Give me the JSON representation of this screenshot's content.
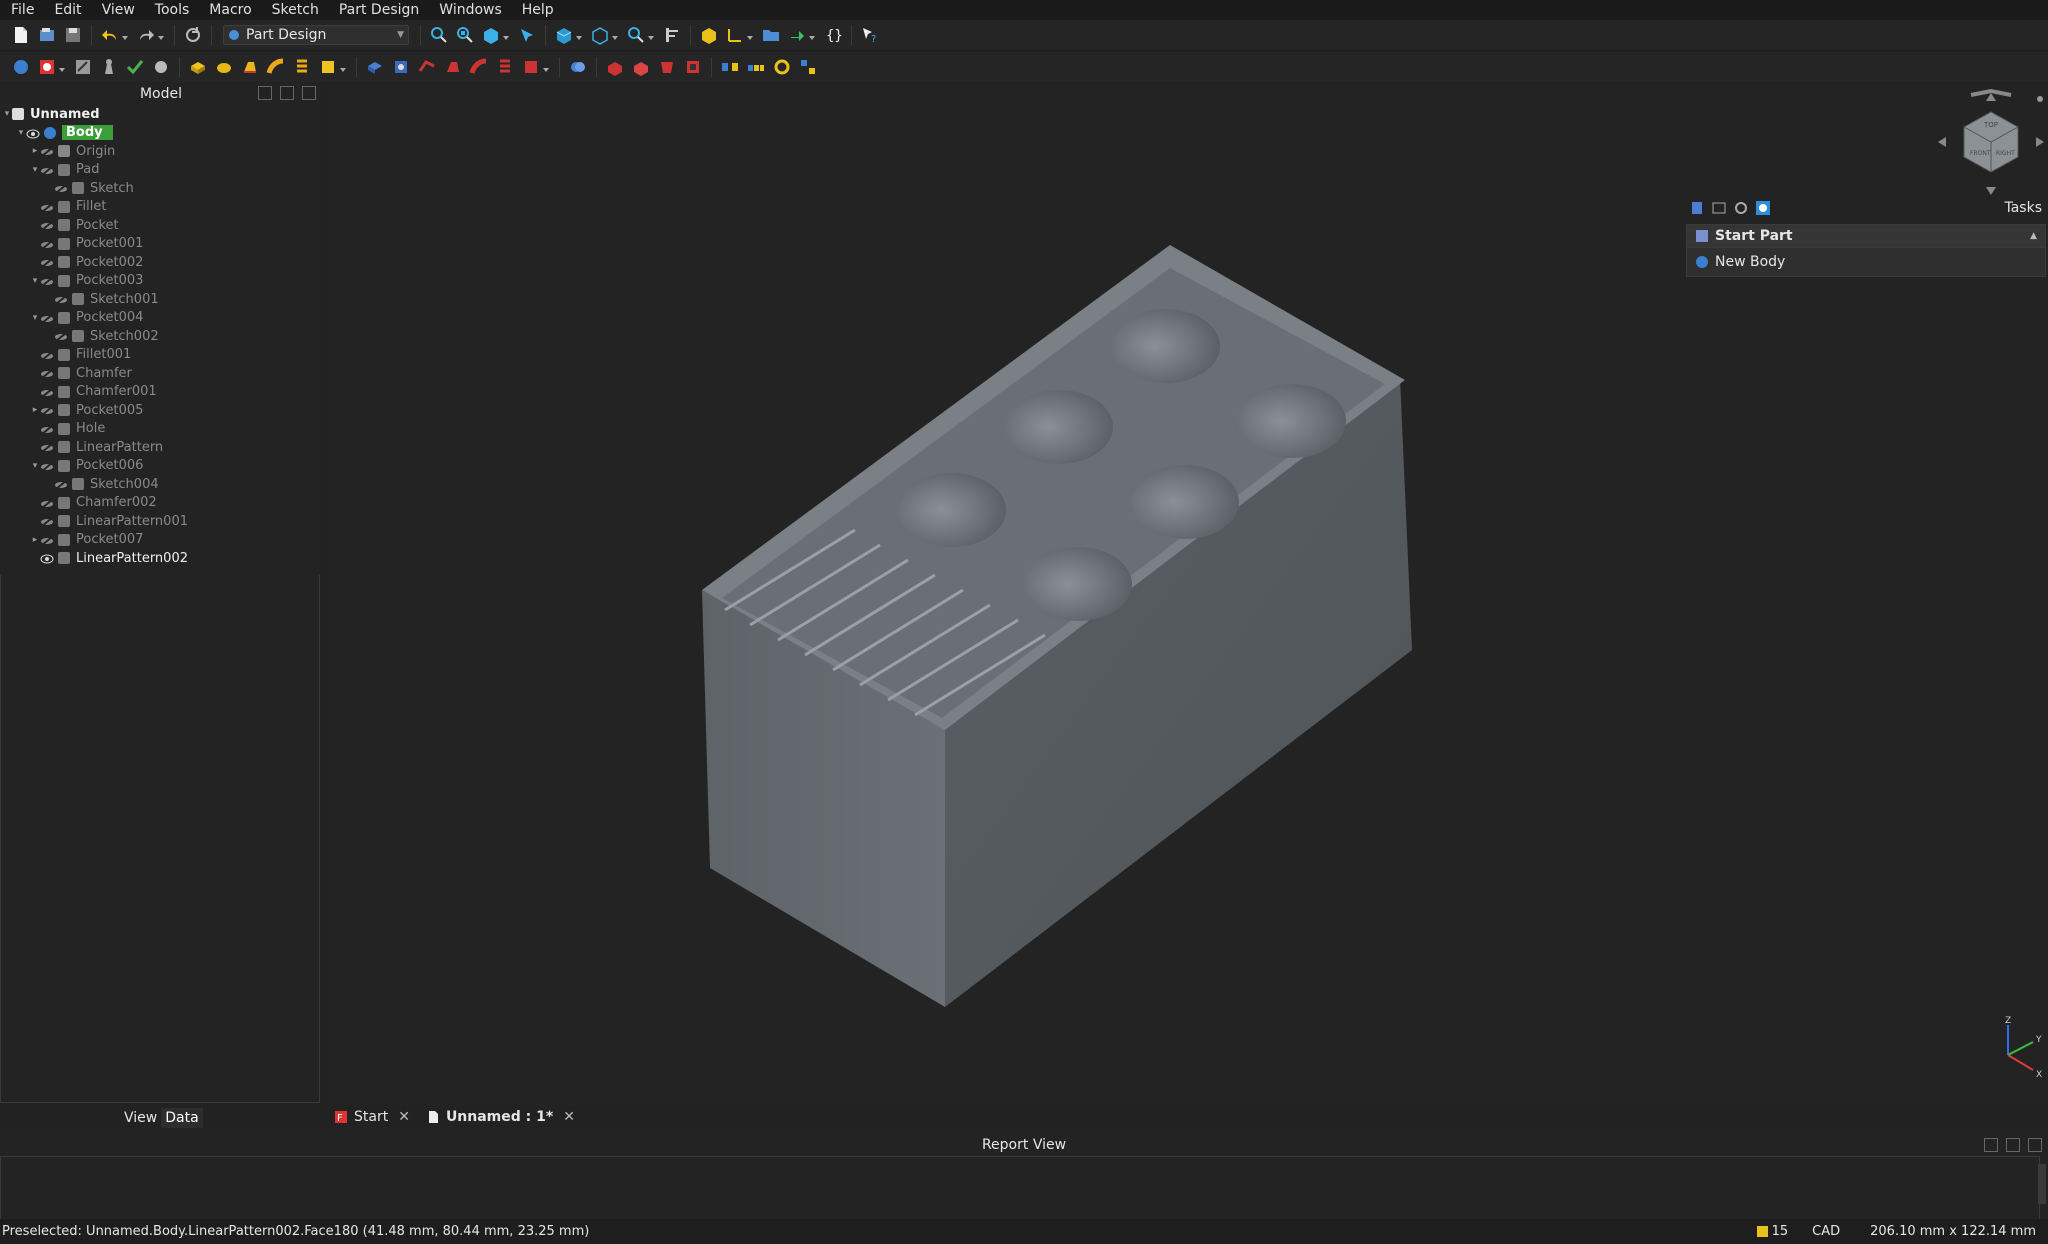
{
  "menu": [
    "File",
    "Edit",
    "View",
    "Tools",
    "Macro",
    "Sketch",
    "Part Design",
    "Windows",
    "Help"
  ],
  "workbench": {
    "label": "Part Design"
  },
  "model_panel": {
    "title": "Model"
  },
  "tree": [
    {
      "label": "Unnamed",
      "level": 0,
      "arrow": "down",
      "bright": true,
      "icon": "document-icon"
    },
    {
      "label": "Body",
      "level": 1,
      "arrow": "down",
      "selected": true,
      "icon": "body-icon"
    },
    {
      "label": "Origin",
      "level": 2,
      "arrow": "right",
      "icon": "origin-icon"
    },
    {
      "label": "Pad",
      "level": 2,
      "arrow": "down",
      "icon": "pad-icon"
    },
    {
      "label": "Sketch",
      "level": 3,
      "arrow": "",
      "icon": "sketch-icon"
    },
    {
      "label": "Fillet",
      "level": 2,
      "arrow": "",
      "icon": "fillet-icon"
    },
    {
      "label": "Pocket",
      "level": 2,
      "arrow": "",
      "icon": "pocket-icon"
    },
    {
      "label": "Pocket001",
      "level": 2,
      "arrow": "",
      "icon": "pocket-icon"
    },
    {
      "label": "Pocket002",
      "level": 2,
      "arrow": "",
      "icon": "pocket-icon"
    },
    {
      "label": "Pocket003",
      "level": 2,
      "arrow": "down",
      "icon": "pocket-icon"
    },
    {
      "label": "Sketch001",
      "level": 3,
      "arrow": "",
      "icon": "sketch-icon"
    },
    {
      "label": "Pocket004",
      "level": 2,
      "arrow": "down",
      "icon": "pocket-icon"
    },
    {
      "label": "Sketch002",
      "level": 3,
      "arrow": "",
      "icon": "sketch-icon"
    },
    {
      "label": "Fillet001",
      "level": 2,
      "arrow": "",
      "icon": "fillet-icon"
    },
    {
      "label": "Chamfer",
      "level": 2,
      "arrow": "",
      "icon": "chamfer-icon"
    },
    {
      "label": "Chamfer001",
      "level": 2,
      "arrow": "",
      "icon": "chamfer-icon"
    },
    {
      "label": "Pocket005",
      "level": 2,
      "arrow": "right",
      "icon": "pocket-icon"
    },
    {
      "label": "Hole",
      "level": 2,
      "arrow": "",
      "icon": "hole-icon"
    },
    {
      "label": "LinearPattern",
      "level": 2,
      "arrow": "",
      "icon": "linear-pattern-icon"
    },
    {
      "label": "Pocket006",
      "level": 2,
      "arrow": "down",
      "icon": "pocket-icon"
    },
    {
      "label": "Sketch004",
      "level": 3,
      "arrow": "",
      "icon": "sketch-icon"
    },
    {
      "label": "Chamfer002",
      "level": 2,
      "arrow": "",
      "icon": "chamfer-icon"
    },
    {
      "label": "LinearPattern001",
      "level": 2,
      "arrow": "",
      "icon": "linear-pattern-icon"
    },
    {
      "label": "Pocket007",
      "level": 2,
      "arrow": "right",
      "icon": "pocket-icon"
    },
    {
      "label": "LinearPattern002",
      "level": 2,
      "arrow": "",
      "bright": true,
      "visible": true,
      "icon": "linear-pattern-icon"
    }
  ],
  "property_tabs": {
    "view": "View",
    "data": "Data"
  },
  "tasks": {
    "title": "Tasks",
    "section": "Start Part",
    "item": "New Body"
  },
  "navcube": {
    "top": "TOP",
    "front": "FRONT",
    "right": "RIGHT"
  },
  "axis": {
    "x": "X",
    "y": "Y",
    "z": "Z"
  },
  "doc_tabs": [
    {
      "label": "Start",
      "active": false
    },
    {
      "label": "Unnamed : 1*",
      "active": true
    }
  ],
  "report": {
    "title": "Report View"
  },
  "status": {
    "message": "Preselected: Unnamed.Body.LinearPattern002.Face180 (41.48 mm, 80.44 mm, 23.25 mm)",
    "count": "15",
    "nav": "CAD",
    "dimensions": "206.10 mm x 122.14 mm"
  },
  "colors": {
    "selection": "#3a9e3a",
    "model": "#6d7277",
    "accent": "#2b90d9"
  }
}
